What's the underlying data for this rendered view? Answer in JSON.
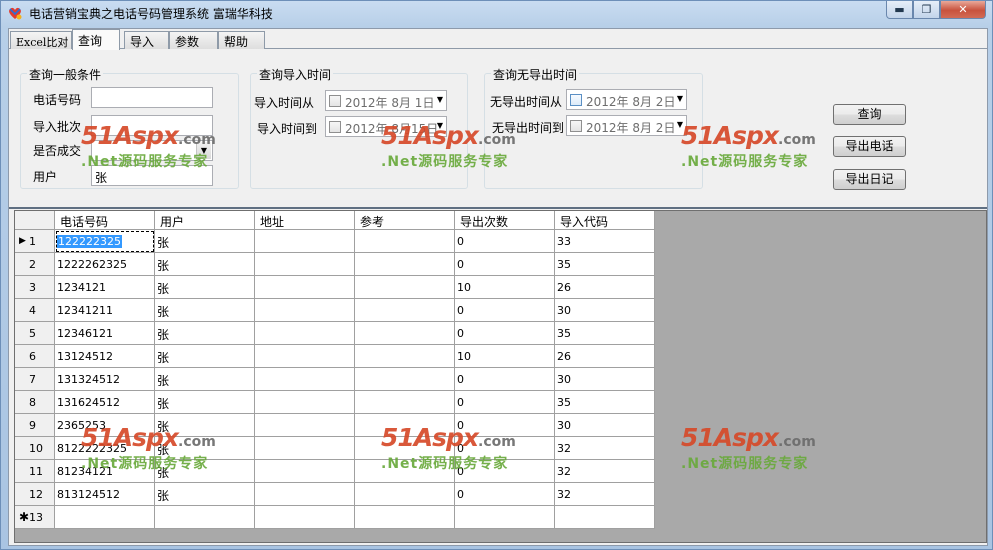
{
  "window": {
    "title": "电话营销宝典之电话号码管理系统  富瑞华科技",
    "minimize_glyph": "▬",
    "maximize_glyph": "❐",
    "close_glyph": "✕"
  },
  "tabs": [
    {
      "label": "Excel比对",
      "active": false
    },
    {
      "label": "查询",
      "active": true
    },
    {
      "label": "导入",
      "active": false
    },
    {
      "label": "参数",
      "active": false
    },
    {
      "label": "帮助",
      "active": false
    }
  ],
  "general": {
    "legend": "查询一般条件",
    "phone_label": "电话号码",
    "phone_value": "",
    "batch_label": "导入批次",
    "batch_value": "",
    "success_label": "是否成交",
    "success_value": "",
    "user_label": "用户",
    "user_value": "张"
  },
  "import_time": {
    "legend": "查询导入时间",
    "from_label": "导入时间从",
    "from_value": "2012年  8月  1日",
    "to_label": "导入时间到",
    "to_value": "2012年  8月15日"
  },
  "no_export_time": {
    "legend": "查询无导出时间",
    "from_label": "无导出时间从",
    "from_value": "2012年  8月  2日",
    "to_label": "无导出时间到",
    "to_value": "2012年  8月  2日"
  },
  "buttons": {
    "query": "查询",
    "export_phone": "导出电话",
    "export_log": "导出日记"
  },
  "grid": {
    "columns": [
      "电话号码",
      "用户",
      "地址",
      "参考",
      "导出次数",
      "导入代码"
    ],
    "rows": [
      {
        "no": "1",
        "phone": "122222325",
        "user": "张",
        "address": "",
        "ref": "",
        "exports": "0",
        "code": "33"
      },
      {
        "no": "2",
        "phone": "1222262325",
        "user": "张",
        "address": "",
        "ref": "",
        "exports": "0",
        "code": "35"
      },
      {
        "no": "3",
        "phone": "1234121",
        "user": "张",
        "address": "",
        "ref": "",
        "exports": "10",
        "code": "26"
      },
      {
        "no": "4",
        "phone": "12341211",
        "user": "张",
        "address": "",
        "ref": "",
        "exports": "0",
        "code": "30"
      },
      {
        "no": "5",
        "phone": "12346121",
        "user": "张",
        "address": "",
        "ref": "",
        "exports": "0",
        "code": "35"
      },
      {
        "no": "6",
        "phone": "13124512",
        "user": "张",
        "address": "",
        "ref": "",
        "exports": "10",
        "code": "26"
      },
      {
        "no": "7",
        "phone": "131324512",
        "user": "张",
        "address": "",
        "ref": "",
        "exports": "0",
        "code": "30"
      },
      {
        "no": "8",
        "phone": "131624512",
        "user": "张",
        "address": "",
        "ref": "",
        "exports": "0",
        "code": "35"
      },
      {
        "no": "9",
        "phone": "2365253",
        "user": "张",
        "address": "",
        "ref": "",
        "exports": "0",
        "code": "30"
      },
      {
        "no": "10",
        "phone": "8122222325",
        "user": "张",
        "address": "",
        "ref": "",
        "exports": "0",
        "code": "32"
      },
      {
        "no": "11",
        "phone": "81234121",
        "user": "张",
        "address": "",
        "ref": "",
        "exports": "0",
        "code": "32"
      },
      {
        "no": "12",
        "phone": "813124512",
        "user": "张",
        "address": "",
        "ref": "",
        "exports": "0",
        "code": "32"
      }
    ],
    "new_row_label": "13",
    "current_row_glyph": "▶",
    "new_row_glyph": "✱"
  },
  "watermark": {
    "brand": "51Aspx",
    "domain": ".com",
    "tagline": ".Net源码服务专家"
  },
  "colors": {
    "selection": "#3399ff",
    "watermark_red": "#d64a2a",
    "watermark_green": "#6aaa3c"
  }
}
